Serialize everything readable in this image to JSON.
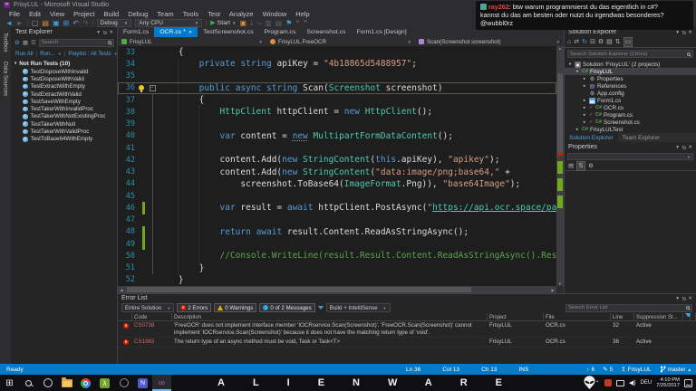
{
  "window": {
    "title": "FrisyLUL - Microsoft Visual Studio"
  },
  "chat_toast": {
    "username": "ray262",
    "username_color": "#e0493e",
    "line1": ": btw warum programmierst du das eigentlich in c#?",
    "line2": "kannst du das am besten oder nutzt du irgendwas besonderes?",
    "line3": "@wubbl0rz"
  },
  "menu": {
    "items": [
      "File",
      "Edit",
      "View",
      "Project",
      "Build",
      "Debug",
      "Team",
      "Tools",
      "Test",
      "Analyze",
      "Window",
      "Help"
    ]
  },
  "toolbar": {
    "config": "Debug",
    "platform": "Any CPU",
    "start": "Start"
  },
  "side_strip": {
    "items": [
      "Toolbox",
      "Data Sources"
    ]
  },
  "test_explorer": {
    "title": "Test Explorer",
    "search_placeholder": "Search",
    "run_all": "Run All",
    "run": "Run...",
    "playlist": "Playlist : All Tests",
    "group": "Not Run Tests (10)",
    "tests": [
      "TestDisposeWithInvalid",
      "TestDisposeWithValid",
      "TestExtractWithEmpty",
      "TestExtractWithValid",
      "TestSaveWithEmpty",
      "TestTakerWithInvalidProc",
      "TestTakerWithNotExistingProc",
      "TestTakerWithNull",
      "TestTakerWithValidProc",
      "TestToBase64WithEmpty"
    ]
  },
  "editor": {
    "tabs": [
      {
        "label": "Form1.cs"
      },
      {
        "label": "OCR.cs",
        "active": true,
        "dirty": true
      },
      {
        "label": "TestScreenshot.cs"
      },
      {
        "label": "Program.cs"
      },
      {
        "label": "Screenshot.cs"
      },
      {
        "label": "Form1.cs [Design]"
      }
    ],
    "breadcrumb": [
      {
        "label": "FrisyLUL",
        "icon": "project"
      },
      {
        "label": "FrisyLUL.FreeOCR",
        "icon": "class"
      },
      {
        "label": "Scan(Screenshot screenshot)",
        "icon": "method"
      }
    ],
    "lines": [
      {
        "n": 33,
        "i": 4,
        "s": [
          [
            "{",
            "pl"
          ]
        ]
      },
      {
        "n": 34,
        "i": 8,
        "s": [
          [
            "private ",
            "kw"
          ],
          [
            "string ",
            "kw"
          ],
          [
            "apiKey = ",
            "pl"
          ],
          [
            "\"4b18865d5488957\"",
            "str"
          ],
          [
            ";",
            "pl"
          ]
        ]
      },
      {
        "n": 35,
        "i": 0,
        "s": []
      },
      {
        "n": 36,
        "i": 8,
        "cur": true,
        "bulb": true,
        "fold": true,
        "s": [
          [
            "public ",
            "kw"
          ],
          [
            "async ",
            "kw"
          ],
          [
            "string ",
            "kw"
          ],
          [
            "Scan",
            "pl sq"
          ],
          [
            "(",
            "pl"
          ],
          [
            "Screenshot",
            "ty"
          ],
          [
            " screenshot)",
            "pl"
          ]
        ]
      },
      {
        "n": 37,
        "i": 8,
        "s": [
          [
            "{",
            "pl"
          ]
        ]
      },
      {
        "n": 38,
        "i": 12,
        "s": [
          [
            "HttpClient",
            "ty"
          ],
          [
            " httpClient = ",
            "pl"
          ],
          [
            "new ",
            "kw"
          ],
          [
            "HttpClient",
            "ty"
          ],
          [
            "();",
            "pl"
          ]
        ]
      },
      {
        "n": 39,
        "i": 0,
        "s": []
      },
      {
        "n": 40,
        "i": 12,
        "s": [
          [
            "var",
            "kw"
          ],
          [
            " content = ",
            "pl"
          ],
          [
            "new",
            "kw sug"
          ],
          [
            " ",
            "pl"
          ],
          [
            "MultipartFormDataContent",
            "ty"
          ],
          [
            "();",
            "pl"
          ]
        ]
      },
      {
        "n": 41,
        "i": 0,
        "s": []
      },
      {
        "n": 42,
        "i": 12,
        "s": [
          [
            "content.Add(",
            "pl"
          ],
          [
            "new ",
            "kw"
          ],
          [
            "StringContent",
            "ty"
          ],
          [
            "(",
            "pl"
          ],
          [
            "this",
            "kw"
          ],
          [
            ".apiKey), ",
            "pl"
          ],
          [
            "\"apikey\"",
            "str"
          ],
          [
            ");",
            "pl"
          ]
        ]
      },
      {
        "n": 43,
        "i": 12,
        "s": [
          [
            "content.Add(",
            "pl"
          ],
          [
            "new ",
            "kw"
          ],
          [
            "StringContent",
            "ty"
          ],
          [
            "(",
            "pl"
          ],
          [
            "\"data:image/png;base64,\"",
            "str"
          ],
          [
            " +",
            "pl"
          ]
        ]
      },
      {
        "n": 44,
        "i": 16,
        "s": [
          [
            "screenshot.ToBase64(",
            "pl"
          ],
          [
            "ImageFormat",
            "ty"
          ],
          [
            ".Png)), ",
            "pl"
          ],
          [
            "\"base64Image\"",
            "str"
          ],
          [
            ");",
            "pl"
          ]
        ]
      },
      {
        "n": 45,
        "i": 0,
        "s": []
      },
      {
        "n": 46,
        "i": 12,
        "bar": true,
        "s": [
          [
            "var",
            "kw"
          ],
          [
            " result = ",
            "pl"
          ],
          [
            "await",
            "kw"
          ],
          [
            " httpClient.PostAsync(",
            "pl"
          ],
          [
            "\"",
            "str"
          ],
          [
            "https://api.ocr.space/parse",
            "url"
          ]
        ]
      },
      {
        "n": 47,
        "i": 0,
        "s": []
      },
      {
        "n": 48,
        "i": 12,
        "bar": true,
        "s": [
          [
            "return ",
            "kw"
          ],
          [
            "await",
            "kw"
          ],
          [
            " result.Content.ReadAsStringAsync();",
            "pl"
          ]
        ]
      },
      {
        "n": 49,
        "i": 0,
        "bar": true,
        "s": []
      },
      {
        "n": 50,
        "i": 12,
        "s": [
          [
            "//Console.WriteLine(result.Result.Content.ReadAsStringAsync().Resu",
            "com"
          ]
        ]
      },
      {
        "n": 51,
        "i": 8,
        "s": [
          [
            "}",
            "pl"
          ]
        ]
      },
      {
        "n": 52,
        "i": 4,
        "s": [
          [
            "}",
            "pl"
          ]
        ]
      }
    ]
  },
  "solution_explorer": {
    "title": "Solution Explorer",
    "search_placeholder": "Search Solution Explorer (Ctrl+ü)",
    "tree": [
      {
        "label": "Solution 'FrisyLUL' (2 projects)",
        "depth": 0,
        "icon": "solution",
        "arrow": "expanded"
      },
      {
        "label": "FrisyLUL",
        "depth": 1,
        "icon": "csproj",
        "arrow": "expanded",
        "selected": true
      },
      {
        "label": "Properties",
        "depth": 2,
        "icon": "properties",
        "arrow": "collapsed"
      },
      {
        "label": "References",
        "depth": 2,
        "icon": "references",
        "arrow": "collapsed"
      },
      {
        "label": "App.config",
        "depth": 2,
        "icon": "config"
      },
      {
        "label": "Form1.cs",
        "depth": 2,
        "icon": "form",
        "arrow": "collapsed"
      },
      {
        "label": "OCR.cs",
        "depth": 2,
        "icon": "csfile",
        "arrow": "collapsed",
        "badge": "edited"
      },
      {
        "label": "Program.cs",
        "depth": 2,
        "icon": "csfile",
        "arrow": "collapsed",
        "badge": "edited"
      },
      {
        "label": "Screenshot.cs",
        "depth": 2,
        "icon": "csfile",
        "arrow": "collapsed",
        "badge": "edited"
      },
      {
        "label": "FrisyLULTest",
        "depth": 1,
        "icon": "csproj",
        "arrow": "collapsed"
      }
    ]
  },
  "panel_tabs": {
    "active": "Solution Explorer",
    "inactive": "Team Explorer"
  },
  "properties": {
    "title": "Properties"
  },
  "error_list": {
    "title": "Error List",
    "scope": "Entire Solution",
    "errors": "2 Errors",
    "warnings": "0 Warnings",
    "messages": "0 of 2 Messages",
    "filter": "Build + IntelliSense",
    "search_placeholder": "Search Error List",
    "columns": [
      "Code",
      "Description",
      "Project",
      "File",
      "Line",
      "Suppression St..."
    ],
    "rows": [
      {
        "code": "CS0738",
        "description": "'FreeOCR' does not implement interface member 'IOCRservice.Scan(Screenshot)'. 'FreeOCR.Scan(Screenshot)' cannot implement 'IOCRservice.Scan(Screenshot)' because it does not have the matching return type of 'void'.",
        "project": "FrisyLUL",
        "file": "OCR.cs",
        "line": "32",
        "suppression": "Active"
      },
      {
        "code": "CS1983",
        "description": "The return type of an async method must be void, Task or Task<T>",
        "project": "FrisyLUL",
        "file": "OCR.cs",
        "line": "36",
        "suppression": "Active"
      }
    ]
  },
  "status_bar": {
    "ready": "Ready",
    "ln": "Ln 36",
    "col": "Col 13",
    "ch": "Ch 13",
    "ins": "INS",
    "pushes": "6",
    "edits": "5",
    "publish": "FrisyLUL",
    "branch": "master"
  },
  "taskbar": {
    "brand": "ALIENWARE",
    "lang": "DEU",
    "time": "4:10 PM",
    "date": "7/25/2017"
  }
}
